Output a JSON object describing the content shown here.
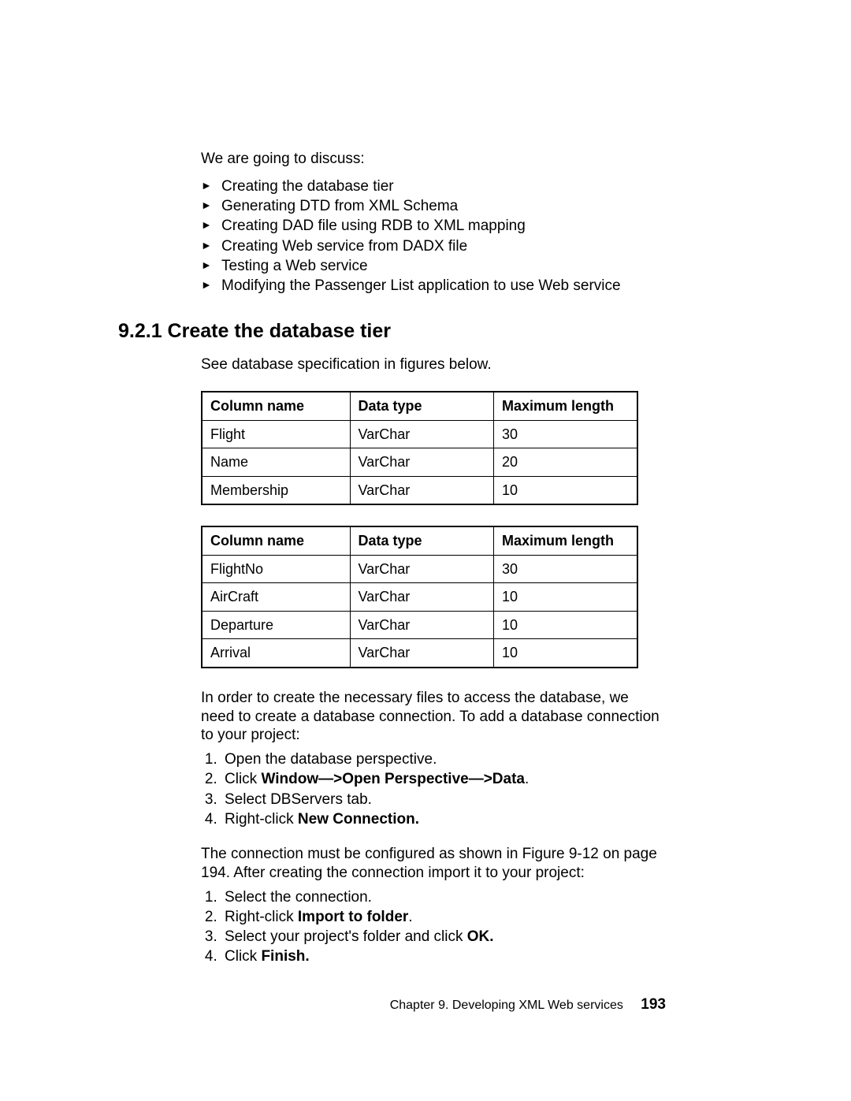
{
  "intro": "We are going to discuss:",
  "bullets": [
    "Creating the database tier",
    "Generating DTD from XML Schema",
    "Creating DAD file using RDB to XML mapping",
    "Creating Web service from DADX file",
    "Testing a Web service",
    "Modifying the Passenger List application to use Web service"
  ],
  "section_heading": "9.2.1  Create the database tier",
  "spec_intro": "See database specification in figures below.",
  "table_headers": {
    "col1": "Column name",
    "col2": "Data type",
    "col3": "Maximum length"
  },
  "table1_rows": [
    {
      "name": "Flight",
      "type": "VarChar",
      "len": "30"
    },
    {
      "name": "Name",
      "type": "VarChar",
      "len": "20"
    },
    {
      "name": "Membership",
      "type": "VarChar",
      "len": "10"
    }
  ],
  "table2_rows": [
    {
      "name": "FlightNo",
      "type": "VarChar",
      "len": "30"
    },
    {
      "name": "AirCraft",
      "type": "VarChar",
      "len": "10"
    },
    {
      "name": "Departure",
      "type": "VarChar",
      "len": "10"
    },
    {
      "name": "Arrival",
      "type": "VarChar",
      "len": "10"
    }
  ],
  "para_after_tables": "In order to create the necessary files to access the database, we need to create a database connection. To add a database connection to your project:",
  "steps1": {
    "s1": "Open the database perspective.",
    "s2_pre": "Click ",
    "s2_bold": "Window—>Open Perspective—>Data",
    "s2_post": ".",
    "s3": "Select DBServers tab.",
    "s4_pre": "Right-click ",
    "s4_bold": "New Connection."
  },
  "para_between": "The connection must be configured as shown in Figure 9-12 on page 194. After creating the connection import it to your project:",
  "steps2": {
    "s1": "Select the connection.",
    "s2_pre": "Right-click ",
    "s2_bold": "Import to folder",
    "s2_post": ".",
    "s3_pre": "Select your project's folder and click ",
    "s3_bold": "OK.",
    "s4_pre": "Click ",
    "s4_bold": "Finish."
  },
  "footer": {
    "chapter": "Chapter 9. Developing XML Web services",
    "page": "193"
  }
}
